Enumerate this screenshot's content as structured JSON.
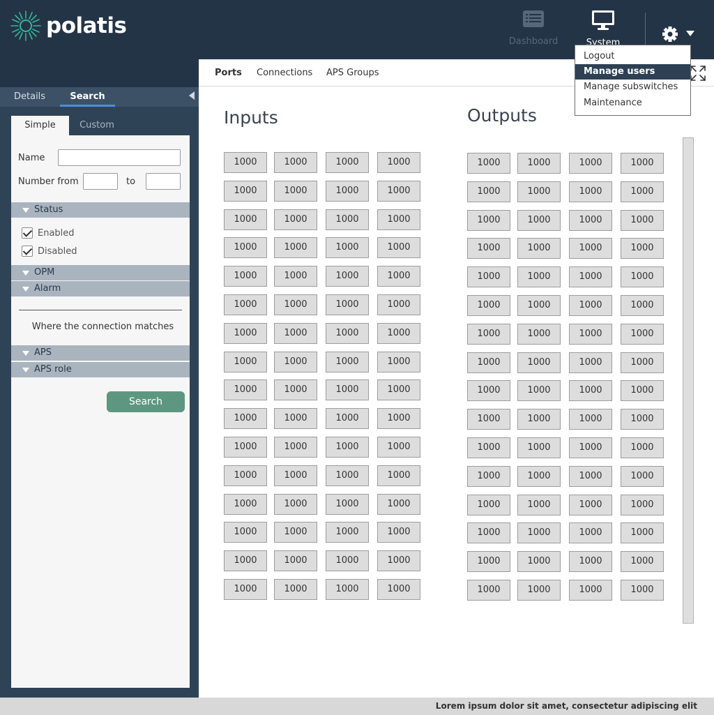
{
  "app": {
    "logo_text": "polatis"
  },
  "header": {
    "nav": [
      {
        "label": "Dashboard",
        "icon": "dashboard-list-icon"
      },
      {
        "label": "System",
        "icon": "monitor-icon"
      }
    ],
    "settings_icon": "gear-icon"
  },
  "settings_menu": {
    "items": [
      "Logout",
      "Manage users",
      "Manage subswitches",
      "Maintenance"
    ],
    "active": "Manage users"
  },
  "side_panel": {
    "tabs": [
      "Details",
      "Search"
    ],
    "active_tab": "Search",
    "subtabs": [
      "Simple",
      "Custom"
    ],
    "active_subtab": "Simple",
    "name_label": "Name",
    "name_value": "",
    "number_from_label": "Number from",
    "to_label": "to",
    "number_from_value": "",
    "number_to_value": "",
    "sections": {
      "status": "Status",
      "opm": "OPM",
      "alarm": "Alarm",
      "aps": "APS",
      "aps_role": "APS role"
    },
    "status_options": [
      {
        "label": "Enabled",
        "checked": true
      },
      {
        "label": "Disabled",
        "checked": true
      }
    ],
    "match_text": "Where the connection matches",
    "search_button": "Search"
  },
  "main": {
    "tabs": [
      "Ports",
      "Connections",
      "APS Groups"
    ],
    "active_tab": "Ports",
    "inputs_title": "Inputs",
    "outputs_title": "Outputs",
    "port_label": "1000",
    "rows": 16,
    "cols": 4
  },
  "footer": {
    "text": "Lorem ipsum dolor sit amet, consectetur adipiscing elit"
  },
  "colors": {
    "header_bg": "#243447",
    "rail_bg": "#2f4357",
    "accent_blue": "#4a90d9",
    "search_button": "#5d9782",
    "logo_accent": "#36b59a"
  }
}
